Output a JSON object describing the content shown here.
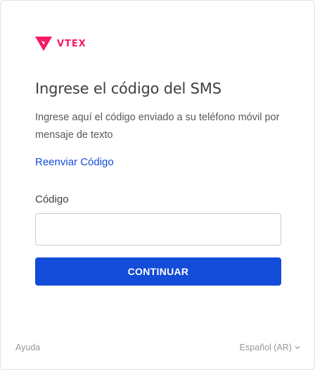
{
  "brand": {
    "name": "VTEX",
    "color": "#f71963",
    "logo_icon": "vtex-logo-icon"
  },
  "header": {
    "title": "Ingrese el código del SMS"
  },
  "description": "Ingrese aquí el código enviado a su teléfono móvil por mensaje de texto",
  "resend_link": "Reenviar Código",
  "code_field": {
    "label": "Código",
    "value": "",
    "placeholder": ""
  },
  "continue_button": "CONTINUAR",
  "footer": {
    "help": "Ayuda",
    "language": "Español (AR)",
    "language_icon": "chevron-down-icon"
  },
  "colors": {
    "primary": "#134cd8",
    "text": "#3f3f40",
    "muted": "#979899"
  }
}
